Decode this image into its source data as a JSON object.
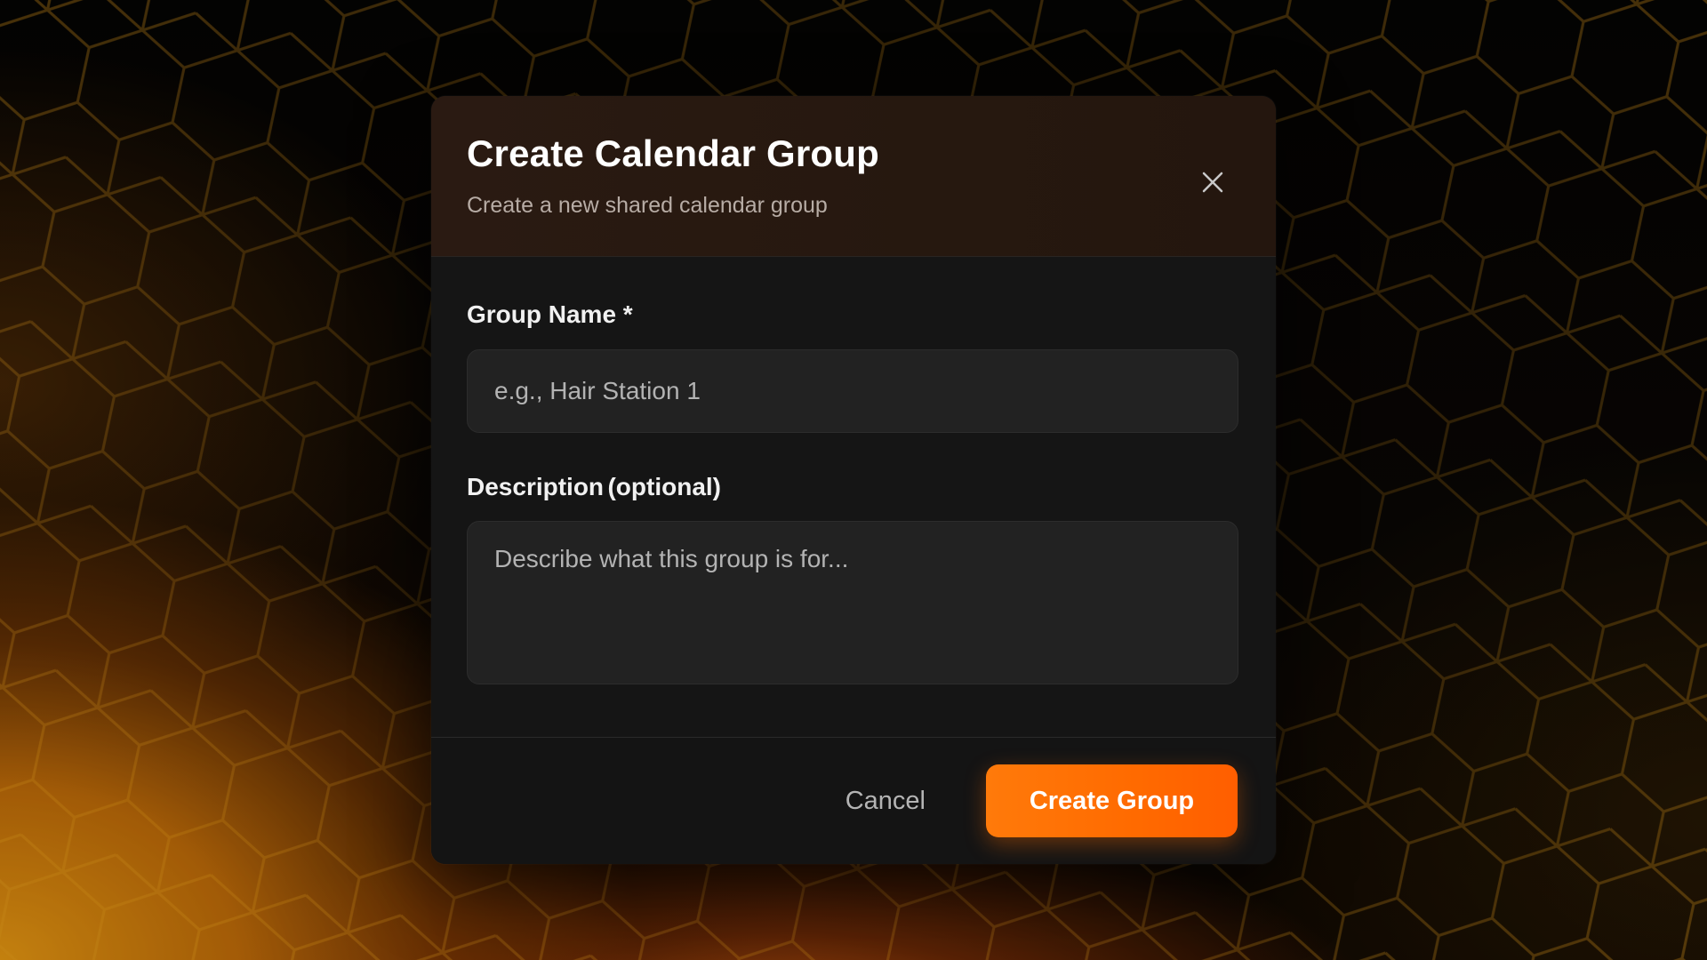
{
  "dialog": {
    "title": "Create Calendar Group",
    "subtitle": "Create a new shared calendar group",
    "close_icon": "close-icon"
  },
  "form": {
    "group_name": {
      "label": "Group Name *",
      "placeholder": "e.g., Hair Station 1",
      "value": ""
    },
    "description": {
      "label": "Description",
      "label_suffix": "(optional)",
      "placeholder": "Describe what this group is for...",
      "value": ""
    }
  },
  "footer": {
    "cancel_label": "Cancel",
    "create_label": "Create Group"
  },
  "colors": {
    "accent": "#ff6a00",
    "header_bg": "#28190f",
    "dialog_bg": "#141414",
    "input_bg": "#222222"
  }
}
